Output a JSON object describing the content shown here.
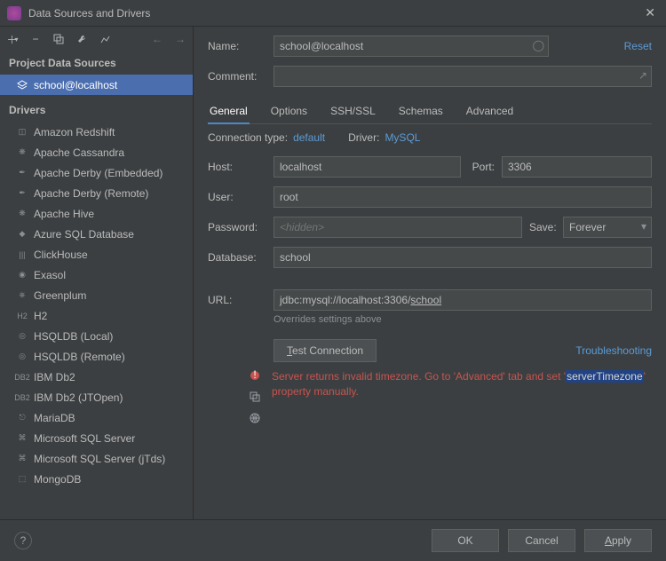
{
  "window": {
    "title": "Data Sources and Drivers"
  },
  "sidebar": {
    "project_header": "Project Data Sources",
    "drivers_header": "Drivers",
    "items": [
      {
        "label": "school@localhost",
        "selected": true
      }
    ],
    "drivers": [
      "Amazon Redshift",
      "Apache Cassandra",
      "Apache Derby (Embedded)",
      "Apache Derby (Remote)",
      "Apache Hive",
      "Azure SQL Database",
      "ClickHouse",
      "Exasol",
      "Greenplum",
      "H2",
      "HSQLDB (Local)",
      "HSQLDB (Remote)",
      "IBM Db2",
      "IBM Db2 (JTOpen)",
      "MariaDB",
      "Microsoft SQL Server",
      "Microsoft SQL Server (jTds)",
      "MongoDB"
    ]
  },
  "form": {
    "name_label": "Name:",
    "name_value": "school@localhost",
    "comment_label": "Comment:",
    "reset": "Reset",
    "tabs": [
      "General",
      "Options",
      "SSH/SSL",
      "Schemas",
      "Advanced"
    ],
    "active_tab": "General",
    "conn_type_label": "Connection type:",
    "conn_type_value": "default",
    "driver_label": "Driver:",
    "driver_value": "MySQL",
    "host_label": "Host:",
    "host_value": "localhost",
    "port_label": "Port:",
    "port_value": "3306",
    "user_label": "User:",
    "user_value": "root",
    "password_label": "Password:",
    "password_placeholder": "<hidden>",
    "save_label": "Save:",
    "save_value": "Forever",
    "database_label": "Database:",
    "database_value": "school",
    "url_label": "URL:",
    "url_prefix": "jdbc:mysql://localhost:3306/",
    "url_suffix": "school",
    "url_hint": "Overrides settings above",
    "test_btn": "Test Connection",
    "troubleshooting": "Troubleshooting",
    "error_pre": "Server returns invalid timezone. Go to 'Advanced' tab and set '",
    "error_hl": "serverTimezone",
    "error_post": "' property manually."
  },
  "footer": {
    "ok": "OK",
    "cancel": "Cancel",
    "apply": "Apply"
  }
}
